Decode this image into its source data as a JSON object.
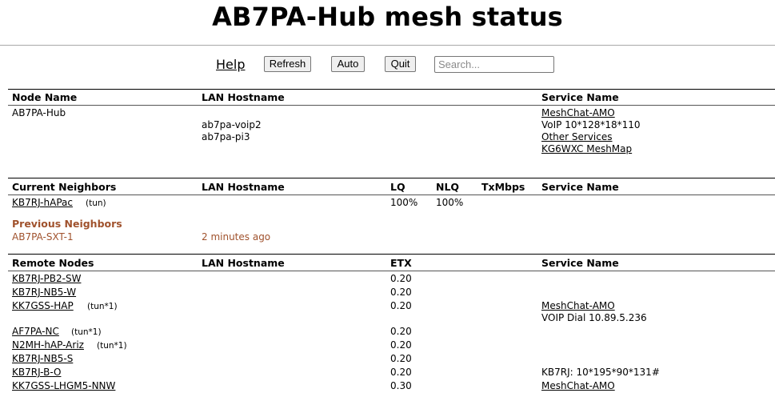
{
  "page_title": "AB7PA-Hub mesh status",
  "toolbar": {
    "help": "Help",
    "refresh": "Refresh",
    "auto": "Auto",
    "quit": "Quit",
    "search_placeholder": "Search..."
  },
  "node_section": {
    "headers": [
      "Node Name",
      "LAN Hostname",
      "Service Name"
    ],
    "node_name": "AB7PA-Hub",
    "lan_hostnames": [
      "ab7pa-voip2",
      "ab7pa-pi3"
    ],
    "services": [
      "MeshChat-AMO",
      "VoIP 10*128*18*110",
      "Other Services",
      "KG6WXC MeshMap"
    ]
  },
  "neighbors_section": {
    "headers": [
      "Current Neighbors",
      "LAN Hostname",
      "LQ",
      "NLQ",
      "TxMbps",
      "Service Name"
    ],
    "rows": [
      {
        "name": "KB7RJ-hAPac",
        "tag": "(tun)",
        "lq": "100%",
        "nlq": "100%"
      }
    ]
  },
  "previous_neighbors": {
    "header": "Previous Neighbors",
    "rows": [
      {
        "name": "AB7PA-SXT-1",
        "when": "2 minutes ago"
      }
    ]
  },
  "remote_section": {
    "headers": [
      "Remote Nodes",
      "LAN Hostname",
      "ETX",
      "Service Name"
    ],
    "rows": [
      {
        "name": "KB7RJ-PB2-SW",
        "tag": "",
        "etx": "0.20",
        "services": []
      },
      {
        "name": "KB7RJ-NB5-W",
        "tag": "",
        "etx": "0.20",
        "services": []
      },
      {
        "name": "KK7GSS-HAP",
        "tag": "(tun*1)",
        "etx": "0.20",
        "services": [
          "MeshChat-AMO",
          "VOIP Dial 10.89.5.236"
        ]
      },
      {
        "name": "AF7PA-NC",
        "tag": "(tun*1)",
        "etx": "0.20",
        "services": []
      },
      {
        "name": "N2MH-hAP-Ariz",
        "tag": "(tun*1)",
        "etx": "0.20",
        "services": []
      },
      {
        "name": "KB7RJ-NB5-S",
        "tag": "",
        "etx": "0.20",
        "services": []
      },
      {
        "name": "KB7RJ-B-O",
        "tag": "",
        "etx": "0.20",
        "services": [
          "KB7RJ: 10*195*90*131#"
        ]
      },
      {
        "name": "KK7GSS-LHGM5-NNW",
        "tag": "",
        "etx": "0.30",
        "services": [
          "MeshChat-AMO"
        ]
      }
    ]
  }
}
